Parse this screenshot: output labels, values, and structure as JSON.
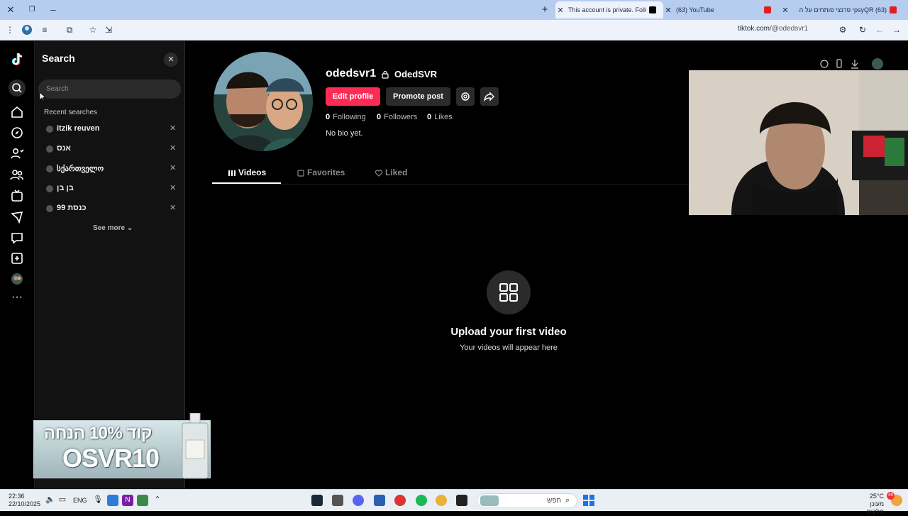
{
  "browser": {
    "tabs": [
      {
        "label": "This account is private. Follow t",
        "active": true
      },
      {
        "label": "(63) YouTube",
        "active": false
      },
      {
        "label": "(63) psyQRי פרנצי פותחים על ה",
        "active": false
      }
    ],
    "url_host": "tiktok.com",
    "url_path": "/@odedsvr1"
  },
  "search_panel": {
    "title": "Search",
    "input_placeholder": "Search",
    "recent_title": "Recent searches",
    "recent_items": [
      "itzik reuven",
      "אנס",
      "სქართველო",
      "בן בן",
      "כנסת 99"
    ],
    "see_more": "See more"
  },
  "profile": {
    "username": "odedsvr1",
    "nickname": "OdedSVR",
    "edit_button": "Edit profile",
    "promote_button": "Promote post",
    "following_count": "0",
    "following_label": "Following",
    "followers_count": "0",
    "followers_label": "Followers",
    "likes_count": "0",
    "likes_label": "Likes",
    "bio": "No bio yet.",
    "tabs": [
      "Videos",
      "Favorites",
      "Liked"
    ],
    "empty_title": "Upload your first video",
    "empty_subtitle": "Your videos will appear here"
  },
  "ad": {
    "line1": "קוד 10% הנחה",
    "line2": "OSVR10"
  },
  "taskbar": {
    "time": "22:36",
    "date": "22/10/2025",
    "language": "ENG",
    "search_text": "חפש",
    "temperature": "25°C",
    "weather": "מעונן חלקית",
    "notification_count": "49"
  },
  "colors": {
    "accent": "#fe2c55",
    "tabbar": "#b6cdf0",
    "panel": "#121212"
  }
}
